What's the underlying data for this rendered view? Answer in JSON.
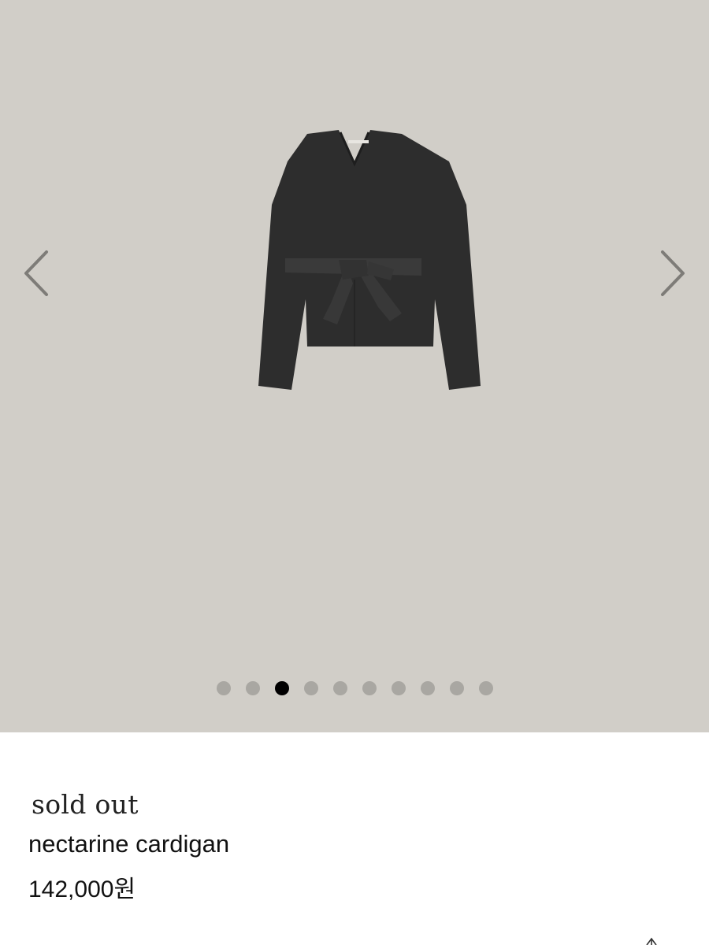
{
  "gallery": {
    "background": "#d1cec8",
    "image_alt": "nectarine cardigan",
    "prev_icon": "chevron-left-icon",
    "next_icon": "chevron-right-icon",
    "total_slides": 10,
    "active_slide": 3
  },
  "product": {
    "status": "sold out",
    "name": "nectarine cardigan",
    "price": "142,000원"
  },
  "share_icon": "share-icon"
}
